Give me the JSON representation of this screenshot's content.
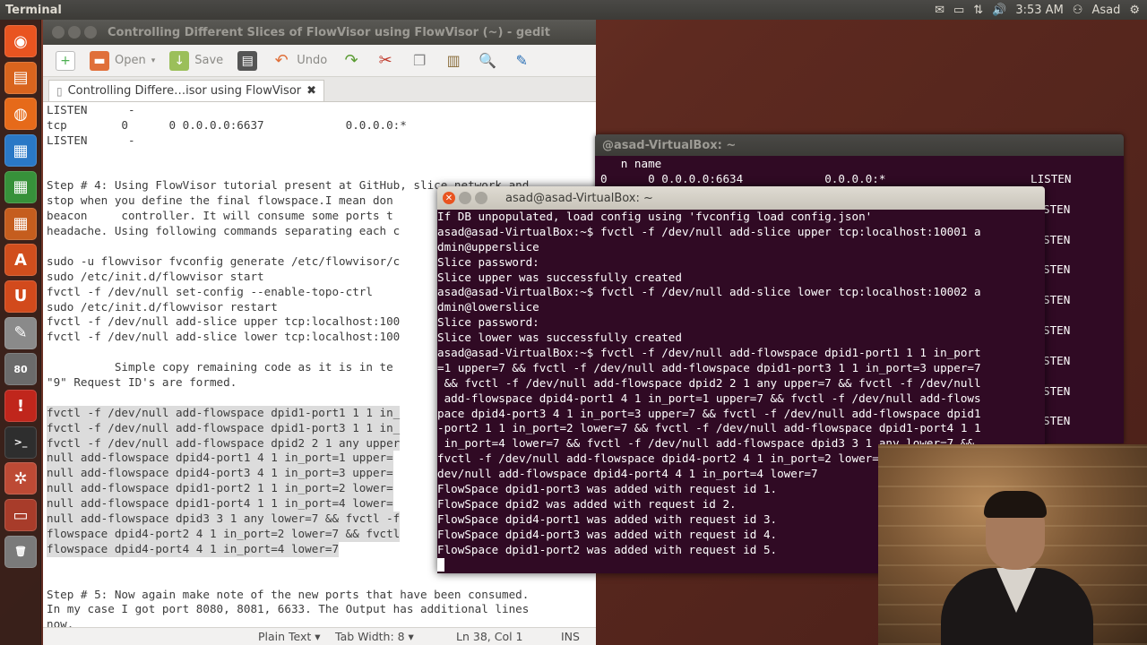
{
  "top_panel": {
    "app_title": "Terminal",
    "time": "3:53 AM",
    "user": "Asad"
  },
  "icons": {
    "mail": "mail-icon",
    "battery": "battery-icon",
    "network": "network-icon",
    "volume": "volume-icon",
    "settings": "gear-icon"
  },
  "colors": {
    "terminal_bg": "#300a24",
    "ubuntu_orange": "#e95420",
    "panel_bg": "#3c3b37"
  },
  "launcher": [
    {
      "name": "dash-home",
      "glyph": "◉",
      "color": "#e95420"
    },
    {
      "name": "files",
      "glyph": "▤",
      "color": "#d9641e"
    },
    {
      "name": "firefox",
      "glyph": "◍",
      "color": "#e66a1a"
    },
    {
      "name": "writer",
      "glyph": "▦",
      "color": "#2a78c6"
    },
    {
      "name": "calc",
      "glyph": "▦",
      "color": "#37913a"
    },
    {
      "name": "impress",
      "glyph": "▦",
      "color": "#c55d1e"
    },
    {
      "name": "software-center",
      "glyph": "A",
      "color": "#d14e1d"
    },
    {
      "name": "ubuntu-one",
      "glyph": "U",
      "color": "#d24a1c"
    },
    {
      "name": "text-editor",
      "glyph": "✎",
      "color": "#8a8a8a"
    },
    {
      "name": "updates",
      "glyph": "80",
      "color": "#6b6b6b"
    },
    {
      "name": "alert",
      "glyph": "!",
      "color": "#c0261c"
    },
    {
      "name": "terminal",
      "glyph": ">_",
      "color": "#2e2e2e"
    },
    {
      "name": "system-settings",
      "glyph": "✲",
      "color": "#bd4a35"
    },
    {
      "name": "workspace",
      "glyph": "▭",
      "color": "#a83c2a"
    },
    {
      "name": "trash",
      "glyph": "🗑",
      "color": "#7a7a7a"
    }
  ],
  "gedit": {
    "window_title": "Controlling Different Slices of FlowVisor using FlowVisor (~) - gedit",
    "toolbar": {
      "open": "Open",
      "save": "Save",
      "undo": "Undo"
    },
    "tab_label": "Controlling Differe…isor using FlowVisor",
    "lines": [
      {
        "t": "LISTEN      -",
        "sel": false
      },
      {
        "t": "tcp        0      0 0.0.0.0:6637            0.0.0.0:*",
        "sel": false
      },
      {
        "t": "LISTEN      -",
        "sel": false
      },
      {
        "t": "",
        "sel": false
      },
      {
        "t": "",
        "sel": false
      },
      {
        "t": "Step # 4: Using FlowVisor tutorial present at GitHub, slice network and",
        "sel": false
      },
      {
        "t": "stop when you define the final flowspace.I mean don",
        "sel": false
      },
      {
        "t": "beacon     controller. It will consume some ports t",
        "sel": false
      },
      {
        "t": "headache. Using following commands separating each c",
        "sel": false
      },
      {
        "t": "",
        "sel": false
      },
      {
        "t": "sudo -u flowvisor fvconfig generate /etc/flowvisor/c",
        "sel": false
      },
      {
        "t": "sudo /etc/init.d/flowvisor start",
        "sel": false
      },
      {
        "t": "fvctl -f /dev/null set-config --enable-topo-ctrl",
        "sel": false
      },
      {
        "t": "sudo /etc/init.d/flowvisor restart",
        "sel": false
      },
      {
        "t": "fvctl -f /dev/null add-slice upper tcp:localhost:100",
        "sel": false
      },
      {
        "t": "fvctl -f /dev/null add-slice lower tcp:localhost:100",
        "sel": false
      },
      {
        "t": "",
        "sel": false
      },
      {
        "t": "          Simple copy remaining code as it is in te",
        "sel": false
      },
      {
        "t": "\"9\" Request ID's are formed.",
        "sel": false
      },
      {
        "t": "",
        "sel": false
      },
      {
        "t": "fvctl -f /dev/null add-flowspace dpid1-port1 1 1 in_",
        "sel": true
      },
      {
        "t": "fvctl -f /dev/null add-flowspace dpid1-port3 1 1 in_",
        "sel": true
      },
      {
        "t": "fvctl -f /dev/null add-flowspace dpid2 2 1 any upper",
        "sel": true
      },
      {
        "t": "null add-flowspace dpid4-port1 4 1 in_port=1 upper=",
        "sel": true
      },
      {
        "t": "null add-flowspace dpid4-port3 4 1 in_port=3 upper=",
        "sel": true
      },
      {
        "t": "null add-flowspace dpid1-port2 1 1 in_port=2 lower=",
        "sel": true
      },
      {
        "t": "null add-flowspace dpid1-port4 1 1 in_port=4 lower=",
        "sel": true
      },
      {
        "t": "null add-flowspace dpid3 3 1 any lower=7 && fvctl -f",
        "sel": true
      },
      {
        "t": "flowspace dpid4-port2 4 1 in_port=2 lower=7 && fvctl",
        "sel": true
      },
      {
        "t": "flowspace dpid4-port4 4 1 in_port=4 lower=7",
        "sel": true
      },
      {
        "t": "",
        "sel": false
      },
      {
        "t": "",
        "sel": false
      },
      {
        "t": "Step # 5: Now again make note of the new ports that have been consumed.",
        "sel": false
      },
      {
        "t": "In my case I got port 8080, 8081, 6633. The Output has additional lines",
        "sel": false
      },
      {
        "t": "now.",
        "sel": false
      }
    ],
    "status": {
      "lang": "Plain Text ▾",
      "tab_width": "Tab Width: 8 ▾",
      "position": "Ln 38, Col 1",
      "mode": "INS"
    }
  },
  "term_back": {
    "title": "@asad-VirtualBox: ~",
    "lines": [
      "   n name",
      "0      0 0.0.0.0:6634            0.0.0.0:*"
    ],
    "listen": [
      "LISTEN",
      "STEN",
      "STEN",
      "STEN",
      "STEN",
      "STEN",
      "STEN",
      "STEN",
      "STEN"
    ]
  },
  "term_front": {
    "title": "asad@asad-VirtualBox: ~",
    "lines": [
      "If DB unpopulated, load config using 'fvconfig load config.json'",
      "asad@asad-VirtualBox:~$ fvctl -f /dev/null add-slice upper tcp:localhost:10001 a",
      "dmin@upperslice",
      "Slice password:",
      "Slice upper was successfully created",
      "asad@asad-VirtualBox:~$ fvctl -f /dev/null add-slice lower tcp:localhost:10002 a",
      "dmin@lowerslice",
      "Slice password:",
      "Slice lower was successfully created",
      "asad@asad-VirtualBox:~$ fvctl -f /dev/null add-flowspace dpid1-port1 1 1 in_port",
      "=1 upper=7 && fvctl -f /dev/null add-flowspace dpid1-port3 1 1 in_port=3 upper=7",
      " && fvctl -f /dev/null add-flowspace dpid2 2 1 any upper=7 && fvctl -f /dev/null",
      " add-flowspace dpid4-port1 4 1 in_port=1 upper=7 && fvctl -f /dev/null add-flows",
      "pace dpid4-port3 4 1 in_port=3 upper=7 && fvctl -f /dev/null add-flowspace dpid1",
      "-port2 1 1 in_port=2 lower=7 && fvctl -f /dev/null add-flowspace dpid1-port4 1 1",
      " in_port=4 lower=7 && fvctl -f /dev/null add-flowspace dpid3 3 1 any lower=7 &&",
      "fvctl -f /dev/null add-flowspace dpid4-port2 4 1 in_port=2 lower=7 && fvctl -f /",
      "dev/null add-flowspace dpid4-port4 4 1 in_port=4 lower=7",
      "FlowSpace dpid1-port3 was added with request id 1.",
      "FlowSpace dpid2 was added with request id 2.",
      "FlowSpace dpid4-port1 was added with request id 3.",
      "FlowSpace dpid4-port3 was added with request id 4.",
      "FlowSpace dpid1-port2 was added with request id 5."
    ]
  }
}
